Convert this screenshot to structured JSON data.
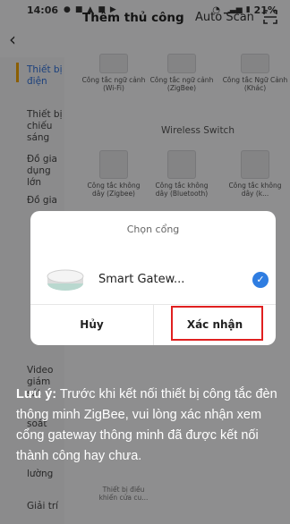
{
  "status_bar": {
    "time": "14:06",
    "battery": "21%"
  },
  "header": {
    "back_icon": "chevron-left-icon",
    "title": "Thêm thủ công",
    "auto_scan": "Auto Scan",
    "scan_icon": "scan-icon"
  },
  "sidebar": {
    "items": [
      {
        "label": "Thiết bị điện",
        "active": true
      },
      {
        "label": "Thiết bị chiếu sáng"
      },
      {
        "label": "Đồ gia dụng lớn"
      },
      {
        "label": "Đồ gia"
      },
      {
        "label": "Video giám sát"
      },
      {
        "label": "soát"
      },
      {
        "label": "lường"
      },
      {
        "label": "Giải trí"
      }
    ]
  },
  "content": {
    "row1": [
      "Công tắc ngữ cảnh (Wi-Fi)",
      "Công tắc ngữ cảnh (ZigBee)",
      "Công tắc Ngữ Cảnh (Khác)"
    ],
    "section_wireless": "Wireless Switch",
    "row2": [
      "Công tắc không dây (Zigbee)",
      "Công tắc không dây (Bluetooth)",
      "Công tắc không dây (k..."
    ],
    "bottom_item": "Thiết bị điều khiển cửa cu..."
  },
  "dialog": {
    "title": "Chọn cổng",
    "gateway_name": "Smart Gatew...",
    "cancel": "Hủy",
    "confirm": "Xác nhận"
  },
  "note": {
    "label": "Lưu ý:",
    "text": " Trước khi kết nối thiết bị công tắc đèn thông minh ZigBee, vui lòng xác nhận xem cổng gateway thông minh đã được kết nối thành công hay chưa."
  },
  "colors": {
    "accent": "#2f7de1",
    "highlight": "#e02020",
    "sidebar_active": "#2f6fd6"
  }
}
